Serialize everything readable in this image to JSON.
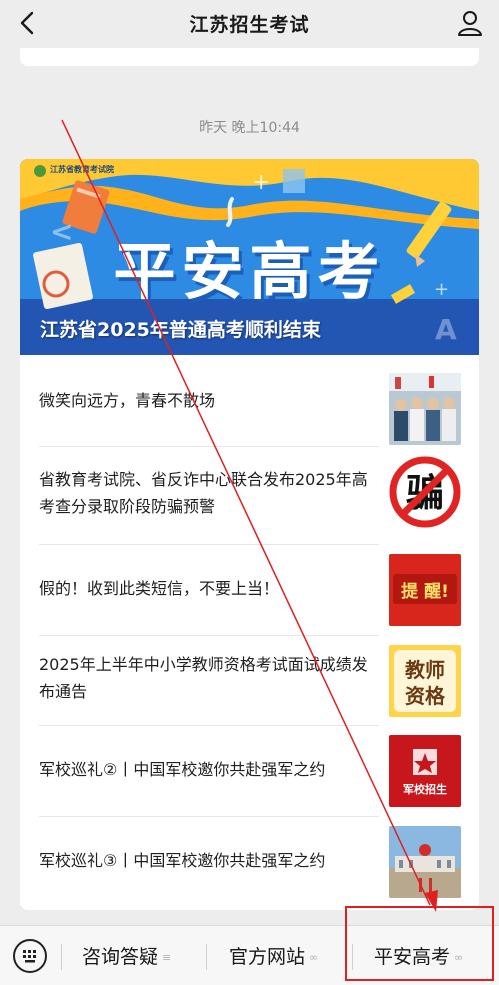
{
  "header": {
    "title": "江苏招生考试",
    "back_icon": "chevron-left-icon",
    "profile_icon": "user-icon"
  },
  "feed": {
    "timestamp": "昨天 晚上10:44"
  },
  "banner": {
    "org_name": "江苏省教育考试院",
    "hero_text": "平安高考",
    "caption": "江苏省2025年普通高考顺利结束"
  },
  "articles": [
    {
      "title": "微笑向远方，青春不散场",
      "thumb_icon": "graduation-photo-thumb"
    },
    {
      "title": "省教育考试院、省反诈中心联合发布2025年高考查分录取阶段防骗预警",
      "thumb_icon": "anti-fraud-thumb",
      "thumb_text": "骗"
    },
    {
      "title": "假的！收到此类短信，不要上当！",
      "thumb_icon": "reminder-thumb",
      "thumb_text": "提 醒!"
    },
    {
      "title": "2025年上半年中小学教师资格考试面试成绩发布通告",
      "thumb_icon": "teacher-qualification-thumb",
      "thumb_text_1": "教师",
      "thumb_text_2": "资格"
    },
    {
      "title": "军校巡礼②丨中国军校邀你共赴强军之约",
      "thumb_icon": "military-recruit-thumb",
      "thumb_text": "军校招生"
    },
    {
      "title": "军校巡礼③丨中国军校邀你共赴强军之约",
      "thumb_icon": "military-campus-thumb"
    }
  ],
  "bottom_menu": {
    "keyboard_icon": "keyboard-icon",
    "items": [
      {
        "label": "咨询答疑",
        "icon": "menu-lines-icon"
      },
      {
        "label": "官方网站",
        "icon": "link-icon"
      },
      {
        "label": "平安高考",
        "icon": "link-icon"
      }
    ]
  },
  "annotation": {
    "color": "#e02020"
  }
}
